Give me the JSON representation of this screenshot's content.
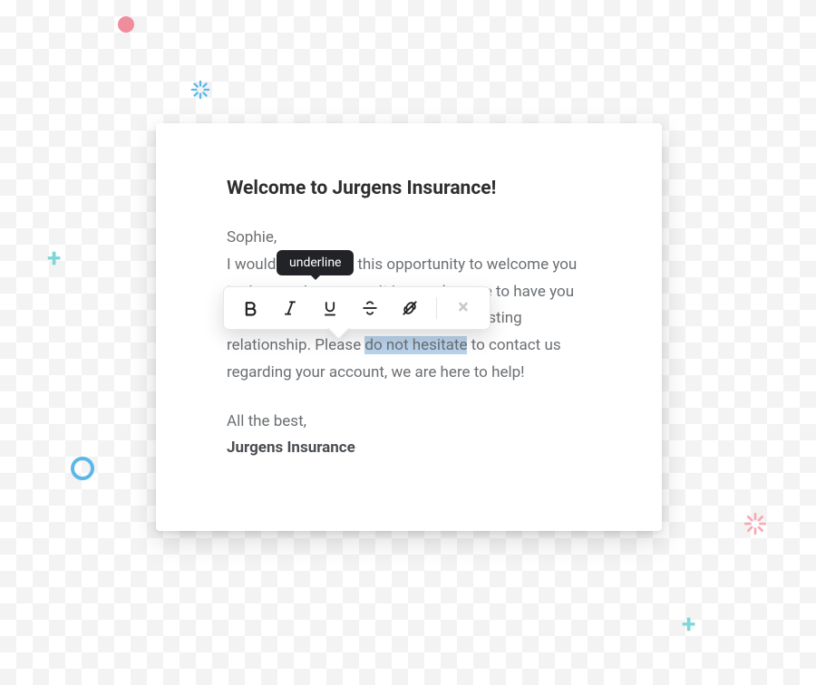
{
  "heading": "Welcome to Jurgens Insurance!",
  "greeting": "Sophie,",
  "body_part1": "I would like to take this opportunity to welcome you to Jurgens Insurance. It is our pleasure to have you as a client, and we look forward to a lasting relationship. Please ",
  "highlighted": "do not hesitate",
  "body_part2": " to contact us regarding your account, we are here to help!",
  "closing": "All the best,",
  "signature": "Jurgens Insurance",
  "toolbar": {
    "tooltip": "underline",
    "buttons": {
      "bold": "bold",
      "italic": "italic",
      "underline": "underline",
      "strikethrough": "strikethrough",
      "unlink": "unlink",
      "close": "close"
    }
  }
}
